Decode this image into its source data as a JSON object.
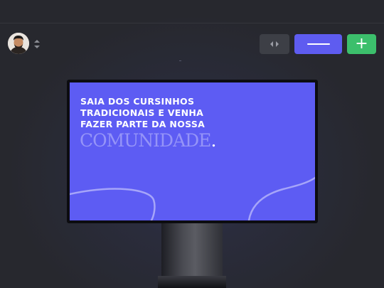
{
  "toolbar": {
    "avatar_icon": "user-avatar",
    "sorter_icon": "sort-updown-icon",
    "arrows_icon": "code-arrows-icon",
    "minus_icon": "minus-bar-icon",
    "add_label": "+"
  },
  "screen": {
    "headline": "SAIA DOS CURSINHOS\nTRADICIONAIS E VENHA\nFAZER PARTE DA NOSSA",
    "highlight": "COMUNIDADE",
    "highlight_dot": "."
  },
  "colors": {
    "background": "#27282e",
    "screen": "#5d5cf3",
    "primary_button": "#5e5cf0",
    "add_button": "#3cbf6c",
    "neutral_button": "#3d3f46"
  }
}
